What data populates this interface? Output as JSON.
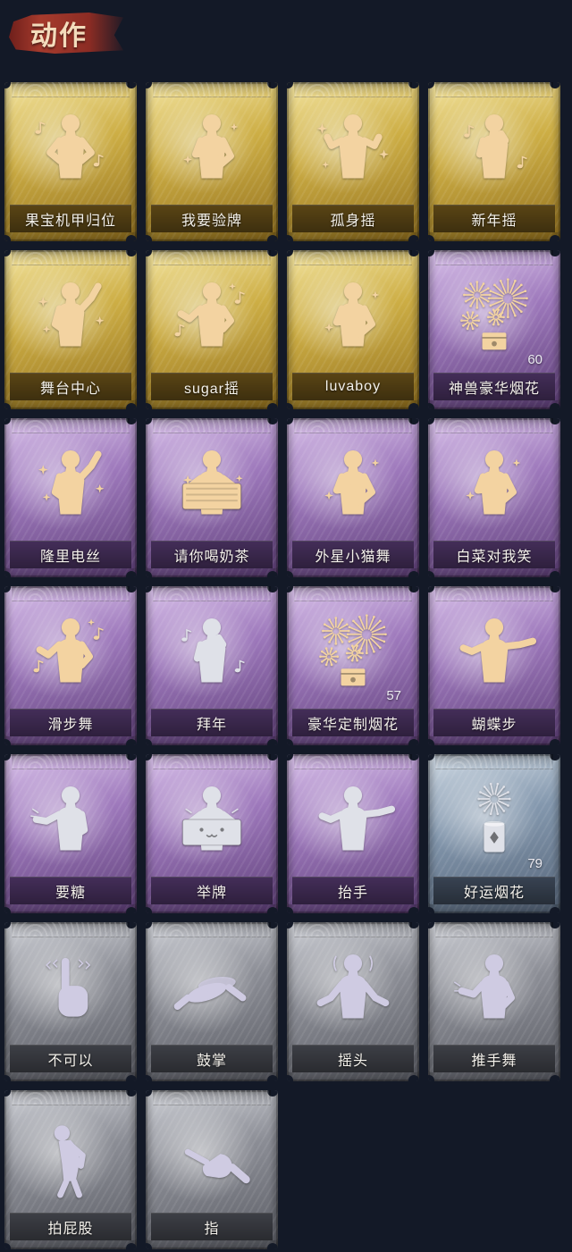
{
  "header": {
    "title": "动作"
  },
  "tiers": {
    "gold": {
      "frame": "#cdae45",
      "light": "#f3e4a0",
      "edge": "#93711f",
      "band": "#5e4816"
    },
    "purple": {
      "frame": "#9d78bb",
      "light": "#d9c2ea",
      "edge": "#5f4079",
      "band": "#47305d"
    },
    "blue": {
      "frame": "#8397ad",
      "light": "#d1dbe5",
      "edge": "#566579",
      "band": "#3b4656"
    },
    "grey": {
      "frame": "#8b8d95",
      "light": "#cfd1d7",
      "edge": "#5b5d65",
      "band": "#404249"
    }
  },
  "icon_tones": {
    "gold": "#f3d3a1",
    "silver": "#dfe1e8",
    "lilac": "#cfcbe2"
  },
  "cards": [
    {
      "label": "果宝机甲归位",
      "tier": "gold",
      "icon": "hands-on-hips-figure-icon",
      "tone": "gold"
    },
    {
      "label": "我要验牌",
      "tier": "gold",
      "icon": "arm-across-figure-icon",
      "tone": "gold"
    },
    {
      "label": "孤身摇",
      "tier": "gold",
      "icon": "sway-figure-icon",
      "tone": "gold"
    },
    {
      "label": "新年摇",
      "tier": "gold",
      "icon": "clasped-hands-figure-icon",
      "tone": "gold"
    },
    {
      "label": "舞台中心",
      "tier": "gold",
      "icon": "raised-arm-figure-icon",
      "tone": "gold"
    },
    {
      "label": "sugar摇",
      "tier": "gold",
      "icon": "side-sway-figure-icon",
      "tone": "gold"
    },
    {
      "label": "luvaboy",
      "tier": "gold",
      "icon": "arm-across-figure-icon",
      "tone": "gold"
    },
    {
      "label": "神兽豪华烟花",
      "tier": "purple",
      "icon": "fireworks-box-icon",
      "tone": "gold",
      "count": "60"
    },
    {
      "label": "隆里电丝",
      "tier": "purple",
      "icon": "raised-arm-figure-icon",
      "tone": "gold"
    },
    {
      "label": "请你喝奶茶",
      "tier": "purple",
      "icon": "sign-figure-icon",
      "tone": "gold"
    },
    {
      "label": "外星小猫舞",
      "tier": "purple",
      "icon": "arm-across-figure-icon",
      "tone": "gold"
    },
    {
      "label": "白菜对我笑",
      "tier": "purple",
      "icon": "arm-across-figure-icon",
      "tone": "gold"
    },
    {
      "label": "滑步舞",
      "tier": "purple",
      "icon": "side-sway-figure-icon",
      "tone": "gold"
    },
    {
      "label": "拜年",
      "tier": "purple",
      "icon": "clasped-hands-figure-icon",
      "tone": "silver"
    },
    {
      "label": "豪华定制烟花",
      "tier": "purple",
      "icon": "fireworks-box-icon",
      "tone": "gold",
      "count": "57"
    },
    {
      "label": "蝴蝶步",
      "tier": "purple",
      "icon": "outstretched-arm-figure-icon",
      "tone": "gold"
    },
    {
      "label": "要糖",
      "tier": "purple",
      "icon": "reaching-figure-icon",
      "tone": "silver"
    },
    {
      "label": "举牌",
      "tier": "purple",
      "icon": "face-sign-figure-icon",
      "tone": "silver"
    },
    {
      "label": "抬手",
      "tier": "purple",
      "icon": "outstretched-arm-figure-icon",
      "tone": "silver"
    },
    {
      "label": "好运烟花",
      "tier": "blue",
      "icon": "firework-can-icon",
      "tone": "silver",
      "count": "79"
    },
    {
      "label": "不可以",
      "tier": "grey",
      "icon": "finger-wag-icon",
      "tone": "lilac"
    },
    {
      "label": "鼓掌",
      "tier": "grey",
      "icon": "clapping-hands-icon",
      "tone": "lilac"
    },
    {
      "label": "摇头",
      "tier": "grey",
      "icon": "head-shake-figure-icon",
      "tone": "lilac"
    },
    {
      "label": "推手舞",
      "tier": "grey",
      "icon": "push-hand-figure-icon",
      "tone": "lilac"
    },
    {
      "label": "拍屁股",
      "tier": "grey",
      "icon": "bending-figure-icon",
      "tone": "lilac"
    },
    {
      "label": "指",
      "tier": "grey",
      "icon": "pointing-hand-icon",
      "tone": "lilac"
    }
  ]
}
